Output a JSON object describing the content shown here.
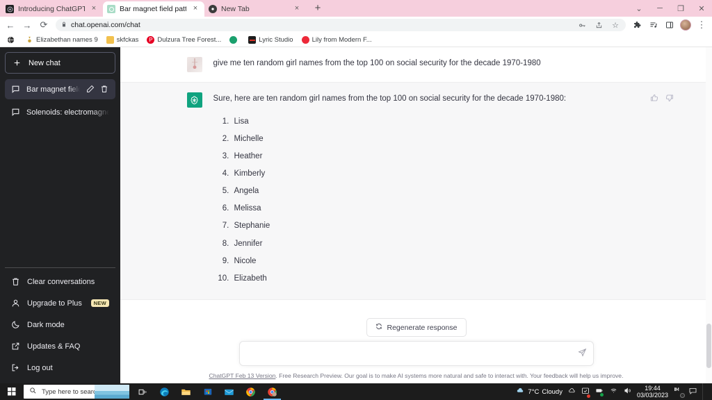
{
  "browser": {
    "tabs": [
      {
        "title": "Introducing ChatGPT",
        "favicon": "chatgpt-dark-icon",
        "active": false,
        "close": "×"
      },
      {
        "title": "Bar magnet field pattern.",
        "favicon": "chatgpt-green-icon",
        "active": true,
        "close": "×"
      },
      {
        "title": "New Tab",
        "favicon": "chrome-icon",
        "active": false,
        "close": "×"
      }
    ],
    "new_tab_label": "+",
    "window_controls": {
      "minimize_group": "⌄",
      "minimize": "─",
      "maximize": "❐",
      "close": "✕"
    },
    "toolbar": {
      "back": "←",
      "forward": "→",
      "reload": "⟳",
      "url": "chat.openai.com/chat",
      "lock": "🔒",
      "key_icon": "⚷",
      "share_icon": "share-icon",
      "star_icon": "☆",
      "extensions_icon": "puzzle-icon",
      "reading_list_icon": "list-icon",
      "sidepanel_icon": "◱",
      "menu_icon": "⋮"
    },
    "bookmarks": [
      {
        "label": "",
        "icon": "globe-icon",
        "color": "#3c3c3c"
      },
      {
        "label": "Elizabethan names 9",
        "icon": "medal-icon",
        "color": "#d4a017"
      },
      {
        "label": "skfckas",
        "icon": "folder-icon",
        "color": "#f2c14e"
      },
      {
        "label": "Dulzura Tree Forest...",
        "icon": "pinterest-icon",
        "color": "#e60023"
      },
      {
        "label": "",
        "icon": "circle-icon",
        "color": "#1aa06d"
      },
      {
        "label": "Lyric Studio",
        "icon": "lyric-icon",
        "color": "#b31217"
      },
      {
        "label": "Lily from Modern F...",
        "icon": "red-circle-icon",
        "color": "#ed2939"
      }
    ],
    "theme_color": "#f6cfdd"
  },
  "sidebar": {
    "new_chat": {
      "label": "New chat",
      "icon": "plus-icon"
    },
    "conversations": [
      {
        "title": "Bar magnet field patter",
        "icon": "chat-bubble-icon",
        "active": true,
        "edit_icon": "pencil-icon",
        "delete_icon": "trash-icon"
      },
      {
        "title": "Solenoids: electromagnetic de",
        "icon": "chat-bubble-icon",
        "active": false
      }
    ],
    "menu": [
      {
        "label": "Clear conversations",
        "icon": "trash-icon"
      },
      {
        "label": "Upgrade to Plus",
        "icon": "user-icon",
        "badge": "NEW"
      },
      {
        "label": "Dark mode",
        "icon": "moon-icon"
      },
      {
        "label": "Updates & FAQ",
        "icon": "external-link-icon"
      },
      {
        "label": "Log out",
        "icon": "logout-icon"
      }
    ],
    "badge_color": "#f6e7b4",
    "background": "#202123"
  },
  "chat": {
    "messages": [
      {
        "role": "user",
        "avatar": "user-photo-avatar",
        "text": "give me ten random girl names from the top 100 on social security for the decade 1970-1980"
      },
      {
        "role": "assistant",
        "avatar": "chatgpt-logo-avatar",
        "text": "Sure, here are ten random girl names from the top 100 on social security for the decade 1970-1980:",
        "list": [
          "Lisa",
          "Michelle",
          "Heather",
          "Kimberly",
          "Angela",
          "Melissa",
          "Stephanie",
          "Jennifer",
          "Nicole",
          "Elizabeth"
        ],
        "feedback": {
          "thumbs_up": "thumbs-up-icon",
          "thumbs_down": "thumbs-down-icon"
        }
      }
    ],
    "regenerate": {
      "label": "Regenerate response",
      "icon": "refresh-icon"
    },
    "input": {
      "value": "",
      "placeholder": "",
      "send_icon": "send-icon"
    },
    "footer": {
      "link": "ChatGPT Feb 13 Version",
      "text": ". Free Research Preview. Our goal is to make AI systems more natural and safe to interact with. Your feedback will help us improve."
    },
    "accent_color": "#10a37f"
  },
  "taskbar": {
    "start_icon": "windows-icon",
    "search_placeholder": "Type here to search",
    "search_icon": "magnifier-icon",
    "apps": [
      {
        "name": "task-view-icon",
        "active": false
      },
      {
        "name": "edge-icon",
        "active": false
      },
      {
        "name": "file-explorer-icon",
        "active": false
      },
      {
        "name": "microsoft-store-icon",
        "active": false
      },
      {
        "name": "mail-icon",
        "active": false
      },
      {
        "name": "chrome-icon",
        "active": false
      },
      {
        "name": "chrome-profile-icon",
        "active": true
      }
    ],
    "weather": {
      "icon": "cloud-icon",
      "temp": "7°C",
      "condition": "Cloudy"
    },
    "tray": [
      {
        "name": "onedrive-icon"
      },
      {
        "name": "update-icon"
      },
      {
        "name": "battery-saver-icon"
      },
      {
        "name": "wifi-icon"
      },
      {
        "name": "volume-icon"
      }
    ],
    "clock": {
      "time": "19:44",
      "date": "03/03/2023"
    },
    "notify_icons": [
      {
        "name": "messenger-icon"
      },
      {
        "name": "action-center-icon"
      }
    ]
  }
}
